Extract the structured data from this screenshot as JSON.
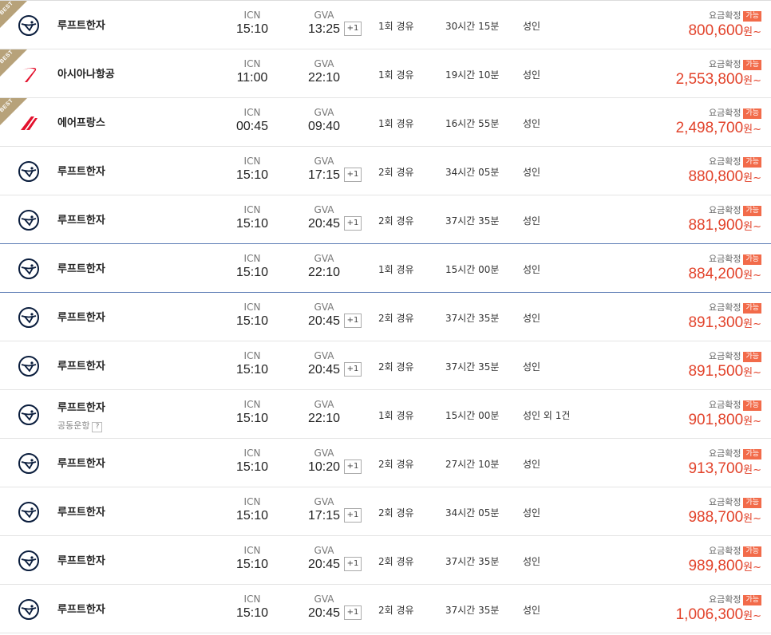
{
  "labels": {
    "best": "BEST",
    "fare_confirm": "요금확정",
    "available": "가능",
    "currency": "원~",
    "next_day": "+1"
  },
  "colors": {
    "accent_price": "#e2432b",
    "badge": "#f26b4a",
    "best_ribbon": "#b7a27a",
    "selected_border": "#5b7bb4"
  },
  "flights": [
    {
      "best": true,
      "logo": "lufthansa-logo",
      "airline": "루프트한자",
      "codeshare": "",
      "dep_code": "ICN",
      "dep_time": "15:10",
      "arr_code": "GVA",
      "arr_time": "13:25",
      "plus1": true,
      "stops": "1회 경유",
      "duration": "30시간 15분",
      "pax": "성인",
      "price": "800,600"
    },
    {
      "best": true,
      "logo": "asiana-logo",
      "airline": "아시아나항공",
      "codeshare": "",
      "dep_code": "ICN",
      "dep_time": "11:00",
      "arr_code": "GVA",
      "arr_time": "22:10",
      "plus1": false,
      "stops": "1회 경유",
      "duration": "19시간 10분",
      "pax": "성인",
      "price": "2,553,800"
    },
    {
      "best": true,
      "logo": "airfrance-logo",
      "airline": "에어프랑스",
      "codeshare": "",
      "dep_code": "ICN",
      "dep_time": "00:45",
      "arr_code": "GVA",
      "arr_time": "09:40",
      "plus1": false,
      "stops": "1회 경유",
      "duration": "16시간 55분",
      "pax": "성인",
      "price": "2,498,700"
    },
    {
      "best": false,
      "logo": "lufthansa-logo",
      "airline": "루프트한자",
      "codeshare": "",
      "dep_code": "ICN",
      "dep_time": "15:10",
      "arr_code": "GVA",
      "arr_time": "17:15",
      "plus1": true,
      "stops": "2회 경유",
      "duration": "34시간 05분",
      "pax": "성인",
      "price": "880,800"
    },
    {
      "best": false,
      "logo": "lufthansa-logo",
      "airline": "루프트한자",
      "codeshare": "",
      "dep_code": "ICN",
      "dep_time": "15:10",
      "arr_code": "GVA",
      "arr_time": "20:45",
      "plus1": true,
      "stops": "2회 경유",
      "duration": "37시간 35분",
      "pax": "성인",
      "price": "881,900"
    },
    {
      "best": false,
      "selected": true,
      "logo": "lufthansa-logo",
      "airline": "루프트한자",
      "codeshare": "",
      "dep_code": "ICN",
      "dep_time": "15:10",
      "arr_code": "GVA",
      "arr_time": "22:10",
      "plus1": false,
      "stops": "1회 경유",
      "duration": "15시간 00분",
      "pax": "성인",
      "price": "884,200"
    },
    {
      "best": false,
      "logo": "lufthansa-logo",
      "airline": "루프트한자",
      "codeshare": "",
      "dep_code": "ICN",
      "dep_time": "15:10",
      "arr_code": "GVA",
      "arr_time": "20:45",
      "plus1": true,
      "stops": "2회 경유",
      "duration": "37시간 35분",
      "pax": "성인",
      "price": "891,300"
    },
    {
      "best": false,
      "logo": "lufthansa-logo",
      "airline": "루프트한자",
      "codeshare": "",
      "dep_code": "ICN",
      "dep_time": "15:10",
      "arr_code": "GVA",
      "arr_time": "20:45",
      "plus1": true,
      "stops": "2회 경유",
      "duration": "37시간 35분",
      "pax": "성인",
      "price": "891,500"
    },
    {
      "best": false,
      "logo": "lufthansa-logo",
      "airline": "루프트한자",
      "codeshare": "공동운항",
      "codeshare_help": "?",
      "dep_code": "ICN",
      "dep_time": "15:10",
      "arr_code": "GVA",
      "arr_time": "22:10",
      "plus1": false,
      "stops": "1회 경유",
      "duration": "15시간 00분",
      "pax": "성인 외 1건",
      "price": "901,800"
    },
    {
      "best": false,
      "logo": "lufthansa-logo",
      "airline": "루프트한자",
      "codeshare": "",
      "dep_code": "ICN",
      "dep_time": "15:10",
      "arr_code": "GVA",
      "arr_time": "10:20",
      "plus1": true,
      "stops": "2회 경유",
      "duration": "27시간 10분",
      "pax": "성인",
      "price": "913,700"
    },
    {
      "best": false,
      "logo": "lufthansa-logo",
      "airline": "루프트한자",
      "codeshare": "",
      "dep_code": "ICN",
      "dep_time": "15:10",
      "arr_code": "GVA",
      "arr_time": "17:15",
      "plus1": true,
      "stops": "2회 경유",
      "duration": "34시간 05분",
      "pax": "성인",
      "price": "988,700"
    },
    {
      "best": false,
      "logo": "lufthansa-logo",
      "airline": "루프트한자",
      "codeshare": "",
      "dep_code": "ICN",
      "dep_time": "15:10",
      "arr_code": "GVA",
      "arr_time": "20:45",
      "plus1": true,
      "stops": "2회 경유",
      "duration": "37시간 35분",
      "pax": "성인",
      "price": "989,800"
    },
    {
      "best": false,
      "logo": "lufthansa-logo",
      "airline": "루프트한자",
      "codeshare": "",
      "dep_code": "ICN",
      "dep_time": "15:10",
      "arr_code": "GVA",
      "arr_time": "20:45",
      "plus1": true,
      "stops": "2회 경유",
      "duration": "37시간 35분",
      "pax": "성인",
      "price": "1,006,300"
    }
  ]
}
